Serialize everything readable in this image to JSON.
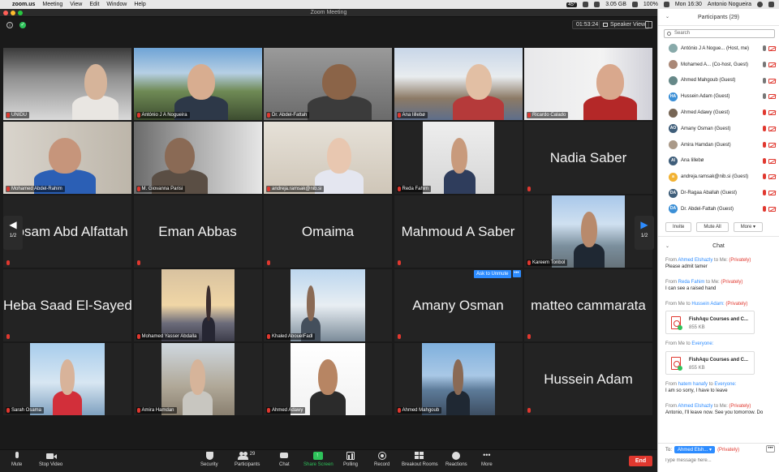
{
  "menubar": {
    "app": "zoom.us",
    "items": [
      "Meeting",
      "View",
      "Edit",
      "Window",
      "Help"
    ],
    "storage": "3.05 GB",
    "battery": "100%",
    "time": "Mon 16:30",
    "user": "Antonio Nogueira",
    "badge": "45°"
  },
  "window": {
    "title": "Zoom Meeting"
  },
  "topbar": {
    "timer": "01:53:24",
    "speaker_view": "Speaker View"
  },
  "pager": {
    "page": "1/2"
  },
  "grid": [
    {
      "name": "UNIDU",
      "display": "",
      "video": "a"
    },
    {
      "name": "António J A Nogueira",
      "display": "",
      "video": "b",
      "active": true
    },
    {
      "name": "Dr. Abdel-Fattah",
      "display": "",
      "video": "c"
    },
    {
      "name": "Ana Iillebø",
      "display": "",
      "video": "d"
    },
    {
      "name": "Ricardo Calado",
      "display": "",
      "video": "e"
    },
    {
      "name": "Mohamed Abdel-Rahim",
      "display": "",
      "video": "f"
    },
    {
      "name": "M. Giovanna Parisi",
      "display": "",
      "video": "g"
    },
    {
      "name": "andreja.ramsak@nib.si",
      "display": "",
      "video": "h"
    },
    {
      "name": "Reda Fahim",
      "display": "",
      "video": "i"
    },
    {
      "name": "",
      "display": "Nadia Saber",
      "video": ""
    },
    {
      "name": "",
      "display": "Hosam Abd Alfattah",
      "video": ""
    },
    {
      "name": "",
      "display": "Eman Abbas",
      "video": ""
    },
    {
      "name": "",
      "display": "Omaima",
      "video": ""
    },
    {
      "name": "",
      "display": "Mahmoud A Saber",
      "video": ""
    },
    {
      "name": "Kareem Tonbol",
      "display": "",
      "video": "k"
    },
    {
      "name": "",
      "display": "Heba Saad El-Sayed",
      "video": ""
    },
    {
      "name": "Mohamed Yasser Abdalla",
      "display": "",
      "video": "l"
    },
    {
      "name": "Khaled AbouelFadl",
      "display": "",
      "video": "m"
    },
    {
      "name": "",
      "display": "Amany Osman",
      "video": "",
      "ask_unmute": "Ask to Unmute"
    },
    {
      "name": "",
      "display": "matteo cammarata",
      "video": ""
    },
    {
      "name": "Sarah Osama",
      "display": "",
      "video": "n"
    },
    {
      "name": "Amira Hamdan",
      "display": "",
      "video": "o"
    },
    {
      "name": "Ahmed Adawy",
      "display": "",
      "video": "p"
    },
    {
      "name": "Ahmed Mahgoub",
      "display": "",
      "video": "q"
    },
    {
      "name": "",
      "display": "Hussein Adam",
      "video": ""
    }
  ],
  "toolbar": {
    "mute": "Mute",
    "stop_video": "Stop Video",
    "security": "Security",
    "participants": "Participants",
    "participants_count": "29",
    "chat": "Chat",
    "share_screen": "Share Screen",
    "polling": "Polling",
    "record": "Record",
    "breakout_rooms": "Breakout Rooms",
    "reactions": "Reactions",
    "more": "More",
    "end": "End"
  },
  "participants": {
    "header": "Participants (29)",
    "search_placeholder": "Search",
    "list": [
      {
        "name": "António J A Nogue... (Host, me)",
        "initials": "",
        "color": "#8aa",
        "mic": "on"
      },
      {
        "name": "Mohamed A... (Co-host, Guest)",
        "initials": "",
        "color": "#a87",
        "mic": "on"
      },
      {
        "name": "Ahmed Mahgoub (Guest)",
        "initials": "",
        "color": "#688",
        "mic": "on"
      },
      {
        "name": "Hussein Adam (Guest)",
        "initials": "HA",
        "color": "#3b8fd6",
        "mic": "on"
      },
      {
        "name": "Ahmed Adawy (Guest)",
        "initials": "",
        "color": "#765",
        "mic": "off"
      },
      {
        "name": "Amany Osman (Guest)",
        "initials": "AO",
        "color": "#3f5e7a",
        "mic": "off"
      },
      {
        "name": "Amira Hamdan (Guest)",
        "initials": "",
        "color": "#a98",
        "mic": "off"
      },
      {
        "name": "Ana Iillebø",
        "initials": "AI",
        "color": "#3f5e7a",
        "mic": "off"
      },
      {
        "name": "andreja.ramsak@nib.si (Guest)",
        "initials": "a",
        "color": "#f2b233",
        "mic": "off"
      },
      {
        "name": "Dr-Ragaa Aballah (Guest)",
        "initials": "DA",
        "color": "#3f5e7a",
        "mic": "off"
      },
      {
        "name": "Dr. Abdel-Fattah (Guest)",
        "initials": "DA",
        "color": "#3b8fd6",
        "mic": "off"
      }
    ],
    "invite": "Invite",
    "mute_all": "Mute All",
    "more": "More"
  },
  "chat": {
    "header": "Chat",
    "messages": [
      {
        "from_prefix": "From",
        "from": "Ahmed Elshazly",
        "to_prefix": "to",
        "to": "Me:",
        "private": "(Privately)",
        "text": "Please admit tamer",
        "file": null
      },
      {
        "from_prefix": "From",
        "from": "Reda Fahim",
        "to_prefix": "to",
        "to": "Me:",
        "private": "(Privately)",
        "text": "I can see a raised hand",
        "file": null
      },
      {
        "from_prefix": "From",
        "from": "Me",
        "to_prefix": "to",
        "to": "Hussein Adam:",
        "private": "(Privately)",
        "text": "",
        "file": {
          "name": "FishAqu Courses and C...",
          "size": "855 KB"
        }
      },
      {
        "from_prefix": "From",
        "from": "Me",
        "to_prefix": "to",
        "to": "Everyone:",
        "private": "",
        "text": "",
        "file": {
          "name": "FishAqu Courses and C...",
          "size": "855 KB"
        }
      },
      {
        "from_prefix": "From",
        "from": "hatem hanafy",
        "to_prefix": "to",
        "to": "Everyone:",
        "private": "",
        "text": "I am so sorry, I have to leave",
        "file": null
      },
      {
        "from_prefix": "From",
        "from": "Ahmed Elshazly",
        "to_prefix": "to",
        "to": "Me:",
        "private": "(Privately)",
        "text": "Antonio, I'll leave now. See you tomorrow. Do",
        "file": null
      }
    ],
    "to_label": "To:",
    "recipient": "Ahmed Elsh...",
    "recipient_private": "(Privately)",
    "input_placeholder": "Type message here..."
  },
  "colors": {
    "accent": "#2d8cff",
    "danger": "#e0382f",
    "share": "#2ec25a",
    "active_border": "#c8d96a"
  }
}
